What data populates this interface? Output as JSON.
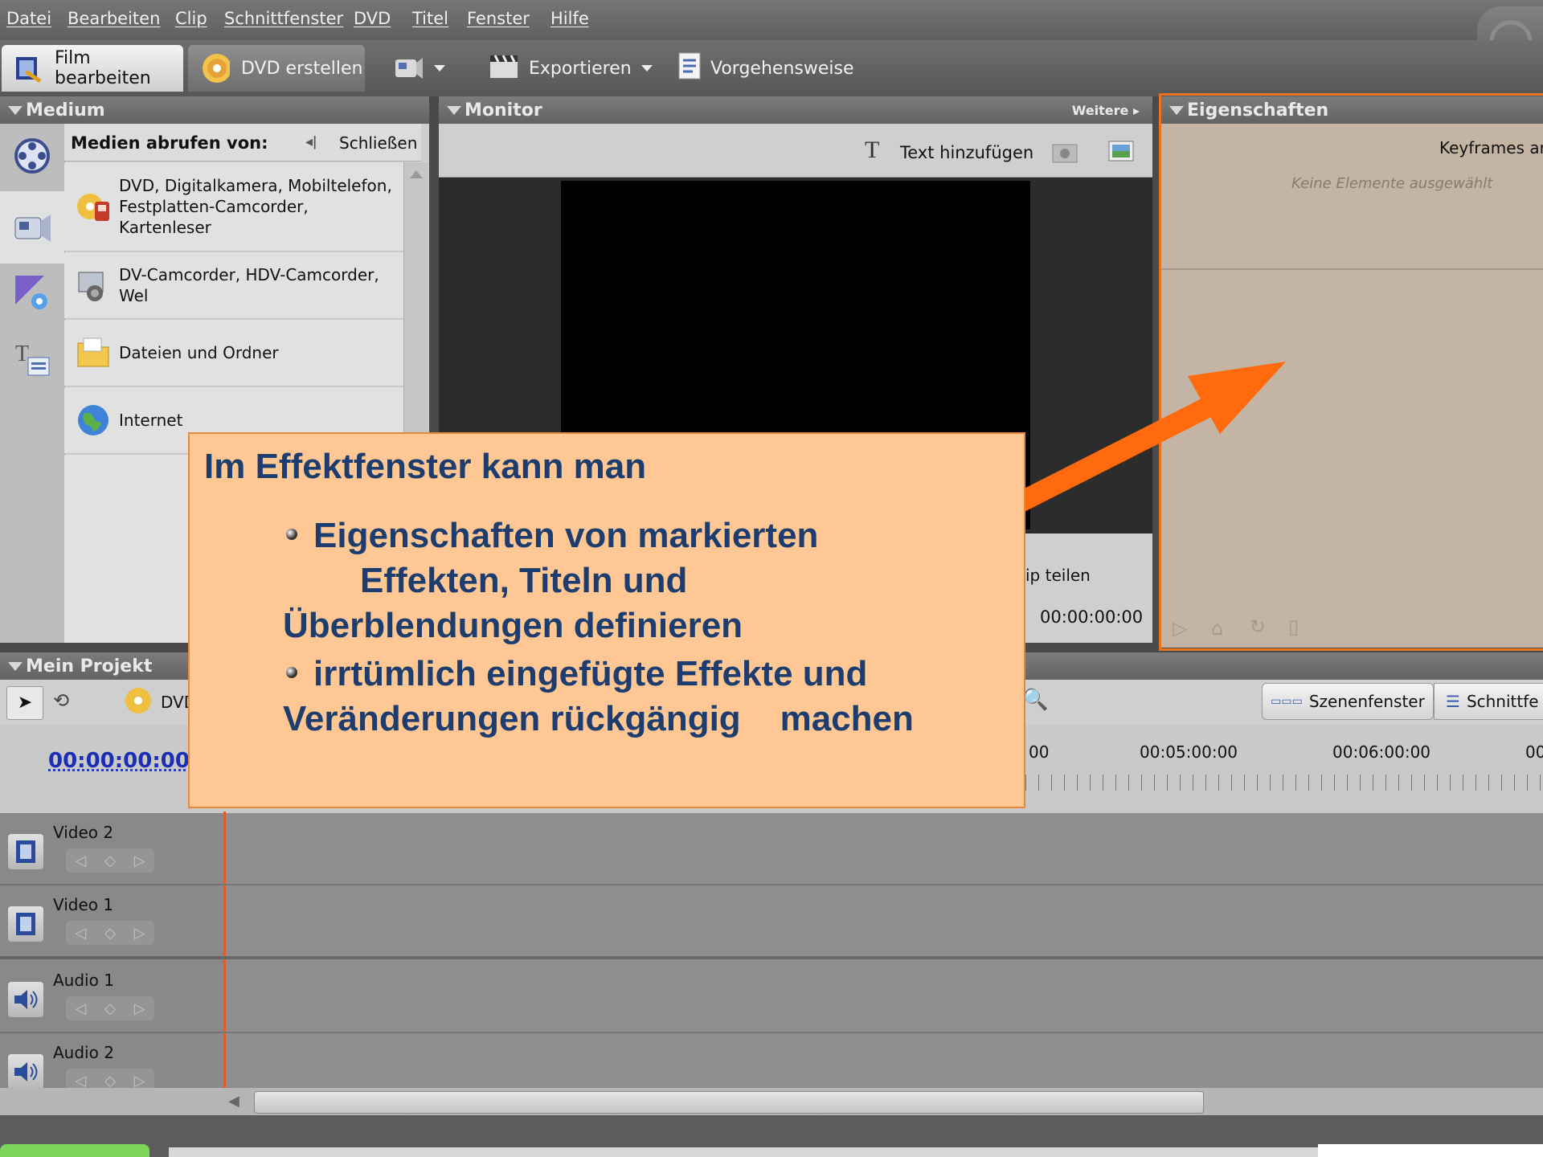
{
  "menu": {
    "items": [
      "Datei",
      "Bearbeiten",
      "Clip",
      "Schnittfenster",
      "DVD",
      "Titel",
      "Fenster",
      "Hilfe"
    ]
  },
  "toolbar": {
    "tab_film": "Film bearbeiten",
    "tab_dvd": "DVD erstellen",
    "export_label": "Exportieren",
    "howto_label": "Vorgehensweise"
  },
  "medium": {
    "title": "Medium",
    "header": "Medien abrufen von:",
    "close_label": "Schließen",
    "sources": [
      {
        "label": "DVD, Digitalkamera, Mobiltelefon,\nFestplatten-Camcorder, Kartenleser",
        "icon": "dvd-camera-icon"
      },
      {
        "label": "DV-Camcorder, HDV-Camcorder, Wel",
        "icon": "dv-camcorder-icon"
      },
      {
        "label": "Dateien und Ordner",
        "icon": "folder-icon"
      },
      {
        "label": "Internet",
        "icon": "globe-icon"
      }
    ]
  },
  "monitor": {
    "title": "Monitor",
    "more_label": "Weitere",
    "add_text_label": "Text hinzufügen",
    "split_label": "ip teilen",
    "timecode": "00:00:00:00"
  },
  "properties": {
    "title": "Eigenschaften",
    "keyframes_label": "Keyframes an",
    "empty_label": "Keine Elemente ausgewählt"
  },
  "project": {
    "title": "Mein Projekt",
    "dvd_label": "DVD",
    "timecode": "00:00:00:00",
    "scene_view_label": "Szenenfenster",
    "timeline_view_label": "Schnittfe",
    "ruler": [
      "00",
      "00:05:00:00",
      "00:06:00:00",
      "00"
    ],
    "tracks": [
      "Video 2",
      "Video 1",
      "Audio 1",
      "Audio 2"
    ]
  },
  "callout": {
    "heading": "Im Effektfenster kann man",
    "bullet1_line1": "Eigenschaften von markierten",
    "bullet1_line2": "Effekten, Titeln und",
    "bullet1_line3": "Überblendungen definieren",
    "bullet2_line1": "irrtümlich eingefügte Effekte und",
    "bullet2_line2": "Veränderungen rückgängig    machen"
  },
  "colors": {
    "accent_arrow": "#ff6a0e",
    "callout_bg": "#ffc794",
    "callout_text": "#1c3d6e",
    "properties_bg": "#c3b4a3",
    "timecode_blue": "#1b2fb4"
  }
}
